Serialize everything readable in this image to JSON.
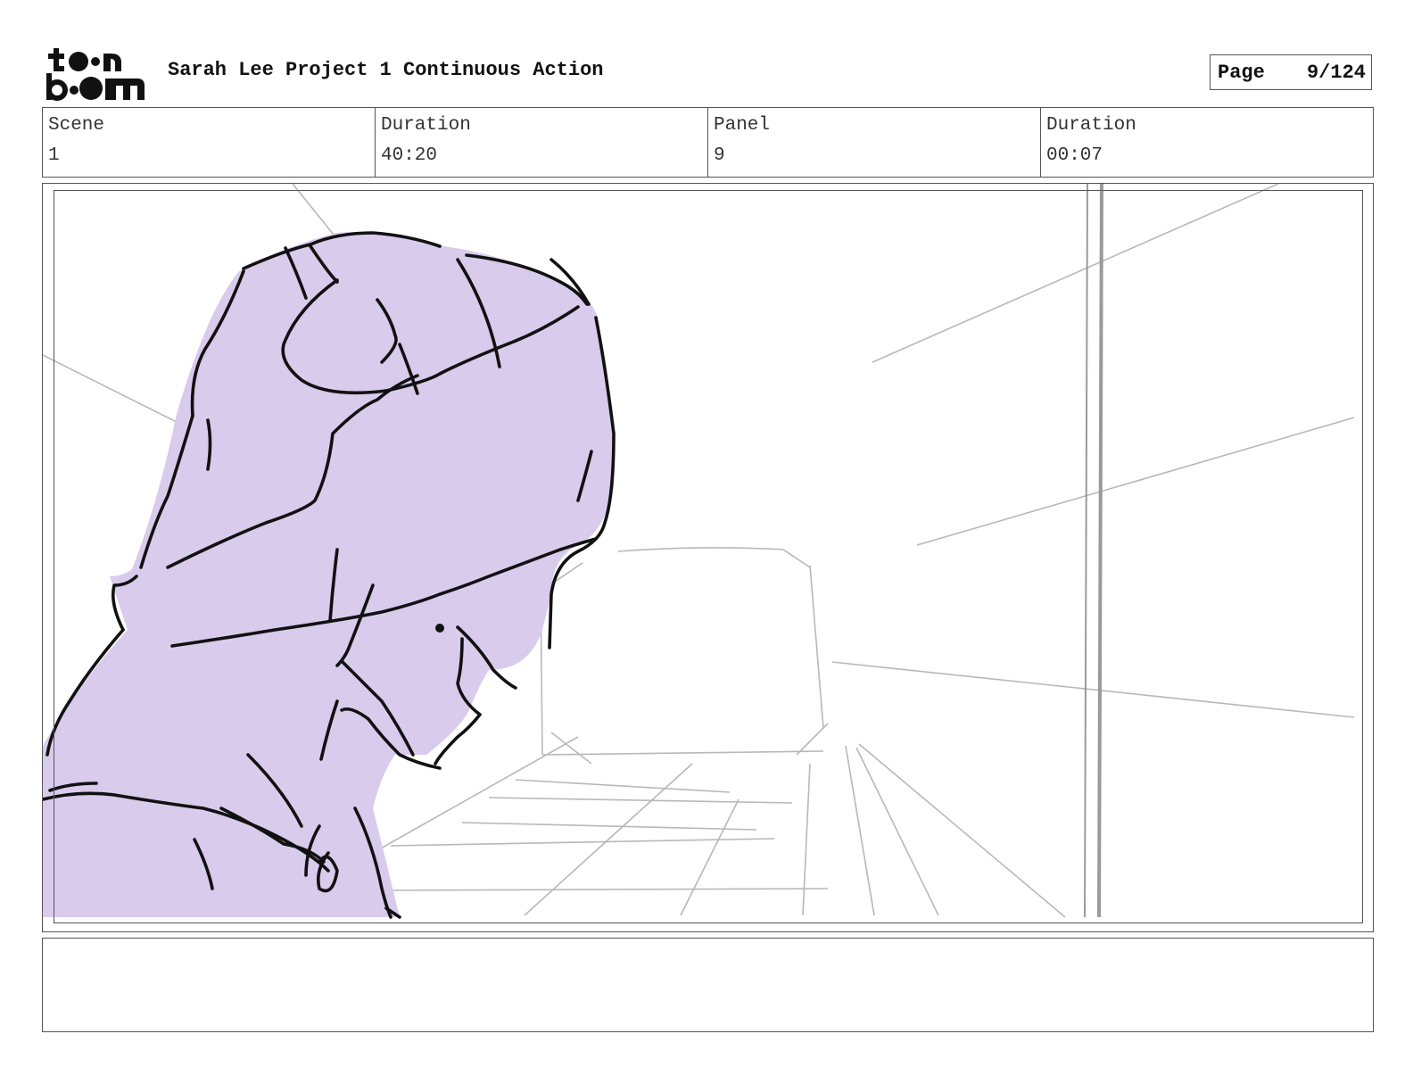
{
  "header": {
    "logo_text": "toon boom",
    "title": "Sarah Lee Project 1 Continuous Action",
    "page_label": "Page",
    "page_value": "9/124"
  },
  "info": {
    "scene_label": "Scene",
    "scene_value": "1",
    "scene_duration_label": "Duration",
    "scene_duration_value": "40:20",
    "panel_label": "Panel",
    "panel_value": "9",
    "panel_duration_label": "Duration",
    "panel_duration_value": "00:07"
  },
  "panel": {
    "character_fill": "#d8cbec",
    "line_color": "#111111",
    "guide_color": "#b5b5b5"
  },
  "notes": {
    "text": ""
  }
}
